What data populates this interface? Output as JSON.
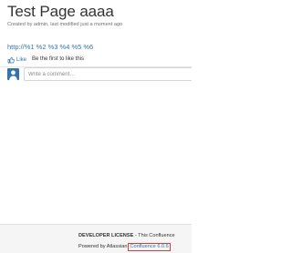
{
  "page": {
    "title": "Test Page aaaa",
    "meta": "Created by admin, last modified just a moment ago",
    "body_link": "http://%1 %2 %3 %4 %5 %6"
  },
  "like": {
    "label": "Like",
    "message": "Be the first to like this",
    "icon": "thumbs-up-icon"
  },
  "comment": {
    "placeholder": "Write a comment…",
    "avatar_icon": "user-avatar-icon"
  },
  "footer": {
    "license_strong": "DEVELOPER LICENSE",
    "license_rest": " - This Confluence",
    "powered_by": "Powered by Atlassian ",
    "version": "Confluence 6.0.6"
  },
  "colors": {
    "link": "#3572b0",
    "avatar": "#3572b0",
    "version_outline": "#d04437"
  }
}
